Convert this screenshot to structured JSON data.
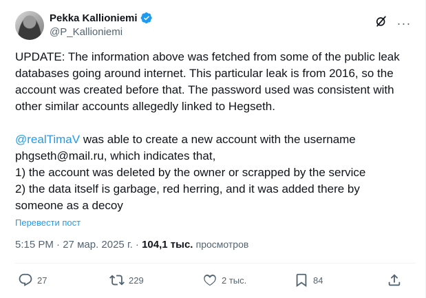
{
  "author": {
    "display_name": "Pekka Kallioniemi",
    "handle": "@P_Kallioniemi",
    "verified": true
  },
  "icons": {
    "verified": "verified-badge-icon",
    "grok": "grok-icon",
    "more": "more-icon",
    "reply": "reply-icon",
    "retweet": "retweet-icon",
    "like": "like-icon",
    "bookmark": "bookmark-icon",
    "share": "share-icon"
  },
  "colors": {
    "accent": "#1d9bf0",
    "text": "#0f1419",
    "secondary": "#536471"
  },
  "tweet": {
    "paragraph1": "UPDATE: The information above was fetched from some of the public leak databases going around internet. This particular leak is from 2016, so the account was created before that. The password used was consistent with other similar accounts allegedly linked to Hegseth.",
    "mention": "@realTimaV",
    "paragraph2_rest": " was able to create a new account with the username phgseth@mail.ru, which indicates that,",
    "line3": "1) the account was deleted by the owner or scrapped by the service",
    "line4": "2) the data itself is garbage, red herring, and it was added there by someone as a decoy",
    "translate_label": "Перевести пост"
  },
  "meta": {
    "time": "5:15 PM",
    "separator": " · ",
    "date": "27 мар. 2025 г.",
    "views_count": "104,1 тыс.",
    "views_label": "просмотров"
  },
  "actions": {
    "replies": "27",
    "retweets": "229",
    "likes": "2 тыс.",
    "bookmarks": "84"
  }
}
